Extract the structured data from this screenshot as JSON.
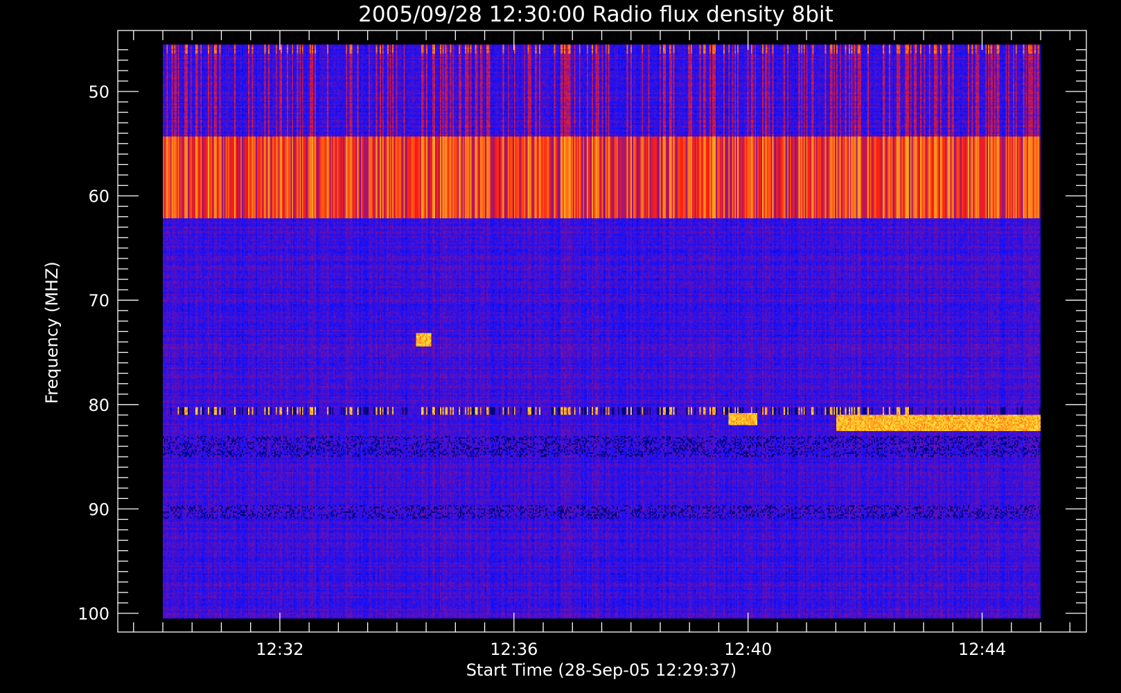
{
  "chart_data": {
    "type": "heatmap",
    "title": "2005/09/28 12:30:00 Radio flux density 8bit",
    "xlabel": "Start Time (28-Sep-05 12:29:37)",
    "ylabel": "Frequency (MHZ)",
    "x_range": [
      "12:30:00",
      "12:45:00"
    ],
    "y_range_mhz": [
      45.5,
      100.5
    ],
    "y_axis_inverted": true,
    "x_ticks": [
      "12:32",
      "12:36",
      "12:40",
      "12:44"
    ],
    "y_ticks": [
      50,
      60,
      70,
      80,
      90,
      100
    ],
    "colormap": [
      "#000050",
      "#1010ff",
      "#7a10a0",
      "#ff2010",
      "#ffa020",
      "#ffff40"
    ],
    "background_color": "#000000",
    "notable_features": [
      {
        "time_start": "12:30:15",
        "time_end": "12:45:00",
        "freq_mhz": [
          54.3,
          62.2
        ],
        "level": "strong broadband vertical striping"
      },
      {
        "time_start": "12:30:15",
        "time_end": "12:42:45",
        "freq_mhz": [
          80.2,
          81.0
        ],
        "level": "intermittent bright bursts"
      },
      {
        "time_start": "12:41:30",
        "time_end": "12:45:00",
        "freq_mhz": [
          81.0,
          82.6
        ],
        "level": "persistent bright band"
      },
      {
        "time_start": "12:39:40",
        "time_end": "12:40:10",
        "freq_mhz": [
          80.8,
          82.0
        ],
        "level": "bright patch"
      },
      {
        "time_start": "12:34:20",
        "time_end": "12:34:35",
        "freq_mhz": [
          73.2,
          74.5
        ],
        "level": "small bright patch"
      }
    ]
  }
}
